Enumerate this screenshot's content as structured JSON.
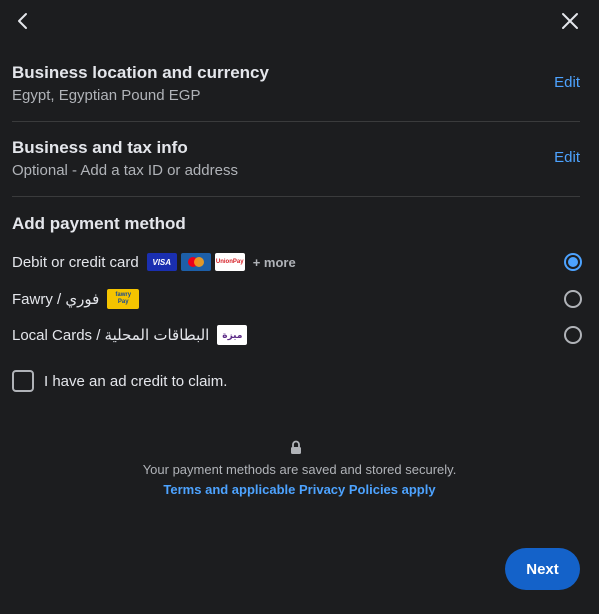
{
  "icons": {
    "back": "back-arrow-icon",
    "close": "close-icon",
    "lock": "lock-icon"
  },
  "location": {
    "title": "Business location and currency",
    "subtitle": "Egypt, Egyptian Pound EGP",
    "edit": "Edit"
  },
  "tax": {
    "title": "Business and tax info",
    "subtitle": "Optional - Add a tax ID or address",
    "edit": "Edit"
  },
  "payment": {
    "title": "Add payment method",
    "options": [
      {
        "label": "Debit or credit card",
        "badges": [
          "VISA",
          "UnionPay"
        ],
        "more": "+ more",
        "selected": true
      },
      {
        "label": "Fawry / فوري",
        "badges": [
          "fawry",
          "Pay"
        ],
        "selected": false
      },
      {
        "label": "Local Cards / البطاقات المحلية",
        "badges": [
          "ميزة"
        ],
        "selected": false
      }
    ]
  },
  "ad_credit": {
    "label": "I have an ad credit to claim.",
    "checked": false
  },
  "secure": {
    "text": "Your payment methods are saved and stored securely.",
    "link": "Terms and applicable Privacy Policies apply"
  },
  "next": {
    "label": "Next"
  },
  "colors": {
    "accent": "#4da3ff",
    "button": "#1462c9",
    "background": "#1c1d1f"
  }
}
